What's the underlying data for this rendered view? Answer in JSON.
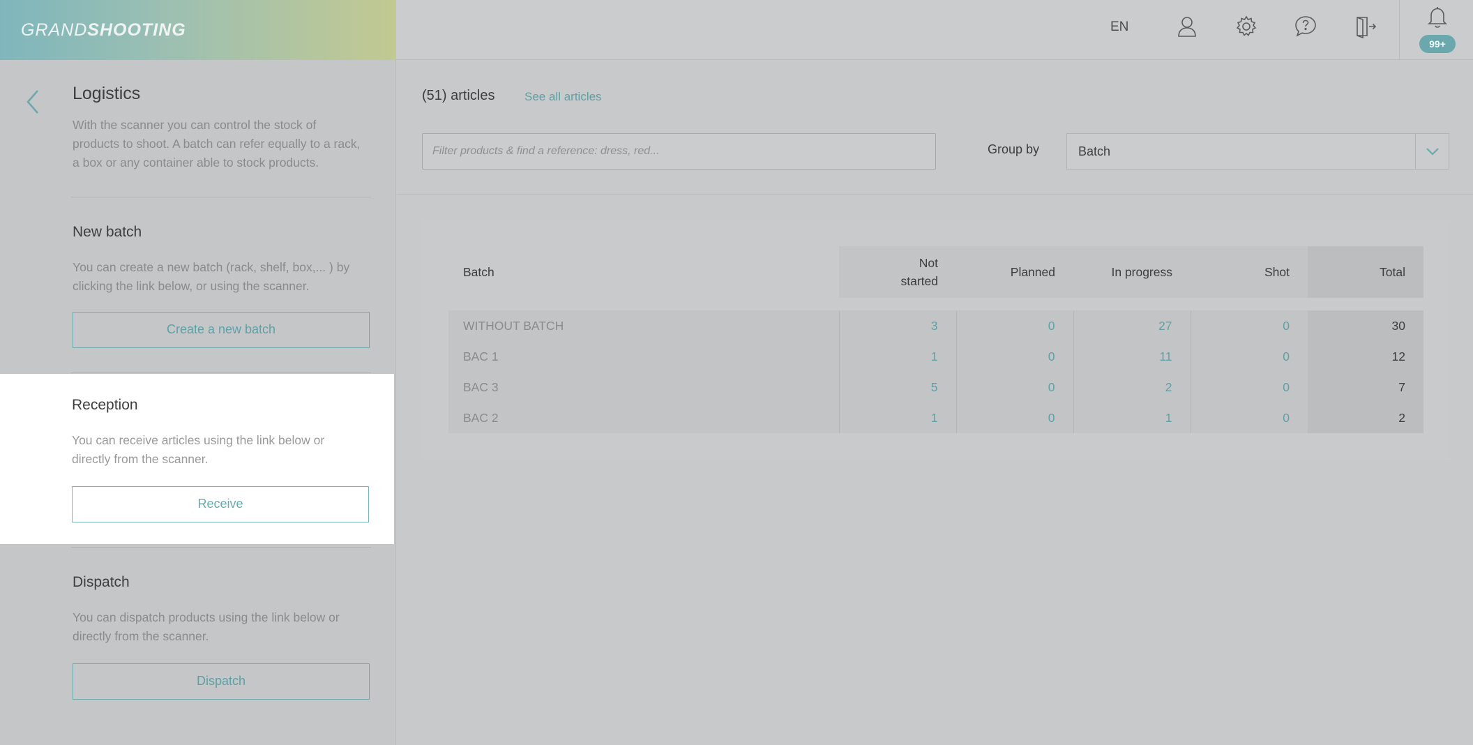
{
  "header": {
    "logo_part1": "GRAND",
    "logo_part2": "SHOOTING",
    "language": "EN",
    "icons": [
      "user-icon",
      "settings-gear-icon",
      "help-chat-icon",
      "logout-door-icon",
      "bell-icon"
    ],
    "notifications_badge": "99+"
  },
  "sidebar": {
    "title": "Logistics",
    "description": "With the scanner you can control the stock of products to shoot. A batch can refer equally to a rack, a box or any container able to stock products.",
    "sections": [
      {
        "title": "New batch",
        "description": "You can create a new batch (rack, shelf, box,... ) by clicking the link below, or using the scanner.",
        "button": "Create a new batch"
      },
      {
        "title": "Reception",
        "description": "You can receive articles using the link below or directly from the scanner.",
        "button": "Receive"
      },
      {
        "title": "Dispatch",
        "description": "You can dispatch products using the link below or directly from the scanner.",
        "button": "Dispatch"
      }
    ]
  },
  "main": {
    "articles_count": "(51) articles",
    "see_all": "See all articles",
    "filter_placeholder": "Filter products & find a reference: dress, red...",
    "group_by_label": "Group by",
    "group_by_value": "Batch",
    "table": {
      "columns": [
        "Batch",
        "Not started",
        "Planned",
        "In progress",
        "Shot",
        "Total"
      ],
      "rows": [
        {
          "batch": "WITHOUT BATCH",
          "not_started": "3",
          "planned": "0",
          "in_progress": "27",
          "shot": "0",
          "total": "30"
        },
        {
          "batch": "BAC 1",
          "not_started": "1",
          "planned": "0",
          "in_progress": "11",
          "shot": "0",
          "total": "12"
        },
        {
          "batch": "BAC 3",
          "not_started": "5",
          "planned": "0",
          "in_progress": "2",
          "shot": "0",
          "total": "7"
        },
        {
          "batch": "BAC 2",
          "not_started": "1",
          "planned": "0",
          "in_progress": "1",
          "shot": "0",
          "total": "2"
        }
      ]
    }
  },
  "colors": {
    "accent": "#5ea0a6",
    "overlay_bg": "#c8c9ca",
    "highlight_panel": "#ffffff",
    "badge": "#6aa8ad"
  }
}
